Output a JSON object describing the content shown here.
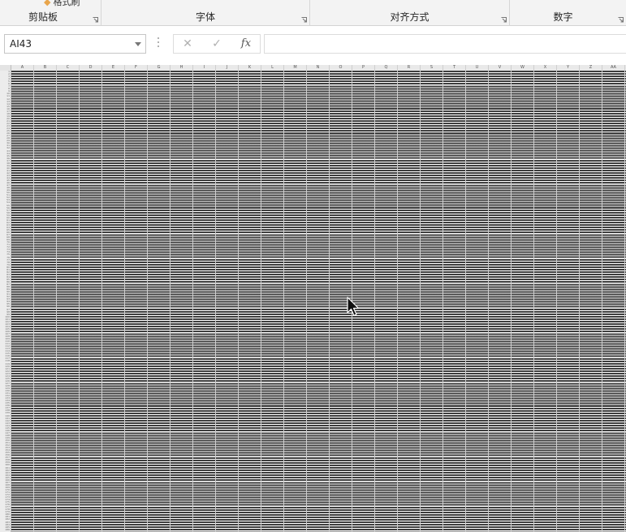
{
  "ribbon": {
    "paste_partial": "格式刷",
    "groups": [
      {
        "label": "剪贴板"
      },
      {
        "label": "字体"
      },
      {
        "label": "对齐方式"
      },
      {
        "label": "数字"
      }
    ]
  },
  "formula_bar": {
    "name_box_value": "AI43",
    "cancel_label": "✕",
    "enter_label": "✓",
    "fx_label": "fx",
    "formula_value": ""
  },
  "sheet": {
    "column_headers": [
      "A",
      "B",
      "C",
      "D",
      "E",
      "F",
      "G",
      "H",
      "I",
      "J",
      "K",
      "L",
      "M",
      "N",
      "O",
      "P",
      "Q",
      "R",
      "S",
      "T",
      "U",
      "V",
      "W",
      "X",
      "Y",
      "Z",
      "AA"
    ],
    "row_count": 186
  }
}
